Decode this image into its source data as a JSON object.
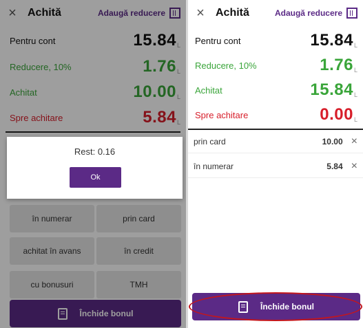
{
  "left": {
    "header": {
      "title": "Achită",
      "discount_link": "Adaugă reducere"
    },
    "totals": [
      {
        "label": "Pentru cont",
        "value": "15.84",
        "currency": "L",
        "tone": "black"
      },
      {
        "label": "Reducere, 10%",
        "value": "1.76",
        "currency": "L",
        "tone": "green"
      },
      {
        "label": "Achitat",
        "value": "10.00",
        "currency": "L",
        "tone": "green"
      },
      {
        "label": "Spre achitare",
        "value": "5.84",
        "currency": "L",
        "tone": "red"
      }
    ],
    "dialog": {
      "message": "Rest: 0.16",
      "ok_label": "Ok"
    },
    "payment_methods": [
      "în numerar",
      "prin card",
      "achitat în avans",
      "în credit",
      "cu bonusuri",
      "TMH"
    ],
    "close_receipt_label": "Închide bonul"
  },
  "right": {
    "header": {
      "title": "Achită",
      "discount_link": "Adaugă reducere"
    },
    "totals": [
      {
        "label": "Pentru cont",
        "value": "15.84",
        "currency": "L",
        "tone": "black"
      },
      {
        "label": "Reducere, 10%",
        "value": "1.76",
        "currency": "L",
        "tone": "green"
      },
      {
        "label": "Achitat",
        "value": "15.84",
        "currency": "L",
        "tone": "green"
      },
      {
        "label": "Spre achitare",
        "value": "0.00",
        "currency": "L",
        "tone": "red"
      }
    ],
    "payments": [
      {
        "method": "prin card",
        "amount": "10.00"
      },
      {
        "method": "în numerar",
        "amount": "5.84"
      }
    ],
    "close_receipt_label": "Închide bonul"
  },
  "colors": {
    "brand": "#5b2a86",
    "green": "#3aa53a",
    "red": "#d71e2a",
    "highlight": "#c4161c"
  },
  "icons": {
    "close": "close-icon",
    "barcode": "barcode-scan-icon",
    "receipt": "receipt-icon",
    "remove": "remove-icon"
  }
}
